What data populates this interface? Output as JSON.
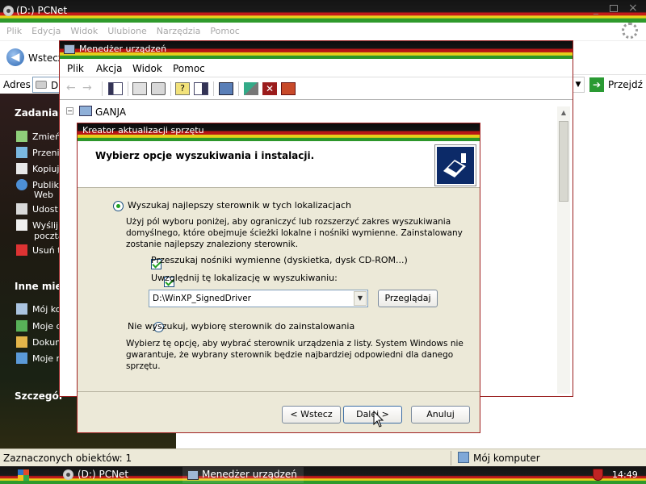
{
  "explorer": {
    "title": "(D:) PCNet",
    "menu": [
      "Plik",
      "Edycja",
      "Widok",
      "Ulubione",
      "Narzędzia",
      "Pomoc"
    ],
    "back_label": "Wstecz",
    "address_label": "Adres",
    "address_value": "D",
    "go_label": "Przejdź",
    "tasks_heading": "Zadania p",
    "tasks": [
      "Zmień",
      "Przeni",
      "Kopiuj",
      "Publiku",
      "Web",
      "Udost",
      "Wyślij",
      "poczta",
      "Usuń t"
    ],
    "other_heading": "Inne miej",
    "other_places": [
      "Mój ko",
      "Moje d",
      "Dokum",
      "Moje r"
    ],
    "details_heading": "Szczegół",
    "status_left": "Zaznaczonych obiektów: 1",
    "status_right": "Mój komputer"
  },
  "device_manager": {
    "title": "Menedżer urządzeń",
    "menu": [
      "Plik",
      "Akcja",
      "Widok",
      "Pomoc"
    ],
    "tree_root": "GANJA"
  },
  "wizard": {
    "title": "Kreator aktualizacji sprzętu",
    "heading": "Wybierz opcje wyszukiwania i instalacji.",
    "option1_label": "Wyszukaj najlepszy sterownik w tych lokalizacjach",
    "option1_desc": "Użyj pól wyboru poniżej, aby ograniczyć lub rozszerzyć zakres wyszukiwania domyślnego, które obejmuje ścieżki lokalne i nośniki wymienne. Zainstalowany zostanie najlepszy znaleziony sterownik.",
    "chk1_label": "Przeszukaj nośniki wymienne (dyskietka, dysk CD-ROM...)",
    "chk2_label": "Uwzględnij tę lokalizację w wyszukiwaniu:",
    "path_value": "D:\\WinXP_SignedDriver",
    "browse_label": "Przeglądaj",
    "option2_label": "Nie wyszukuj, wybiorę sterownik do zainstalowania",
    "option2_desc": "Wybierz tę opcję, aby wybrać sterownik urządzenia z listy. System Windows nie gwarantuje, że wybrany sterownik będzie najbardziej odpowiedni dla danego sprzętu.",
    "back_label": "< Wstecz",
    "next_label": "Dalej >",
    "cancel_label": "Anuluj"
  },
  "taskbar": {
    "items": [
      "(D:) PCNet",
      "Menedżer urządzeń"
    ],
    "clock": "14:49"
  }
}
